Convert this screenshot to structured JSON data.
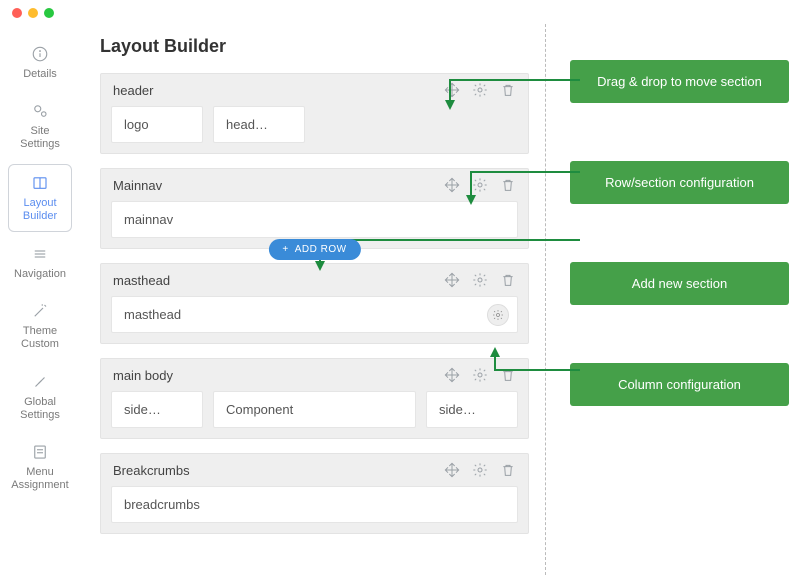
{
  "sidebar": {
    "items": [
      {
        "label": "Details",
        "icon": "info-icon"
      },
      {
        "label": "Site Settings",
        "icon": "cogs-icon"
      },
      {
        "label": "Layout Builder",
        "icon": "layout-icon"
      },
      {
        "label": "Navigation",
        "icon": "menu-icon"
      },
      {
        "label": "Theme Custom",
        "icon": "wand-icon"
      },
      {
        "label": "Global Settings",
        "icon": "tools-icon"
      },
      {
        "label": "Menu Assignment",
        "icon": "list-icon"
      }
    ]
  },
  "page": {
    "title": "Layout Builder"
  },
  "sections": [
    {
      "title": "header",
      "cols": [
        "logo",
        "head…"
      ]
    },
    {
      "title": "Mainnav",
      "cols": [
        "mainnav"
      ],
      "addRow": true
    },
    {
      "title": "masthead",
      "cols": [
        "masthead"
      ],
      "colGear": true
    },
    {
      "title": "main body",
      "cols": [
        "side…",
        "Component",
        "side…"
      ]
    },
    {
      "title": "Breakcrumbs",
      "cols": [
        "breadcrumbs"
      ]
    }
  ],
  "addRow": {
    "label": "ADD ROW",
    "plus": "+"
  },
  "tips": [
    "Drag & drop to move section",
    "Row/section configuration",
    "Add new section",
    "Column configuration"
  ]
}
